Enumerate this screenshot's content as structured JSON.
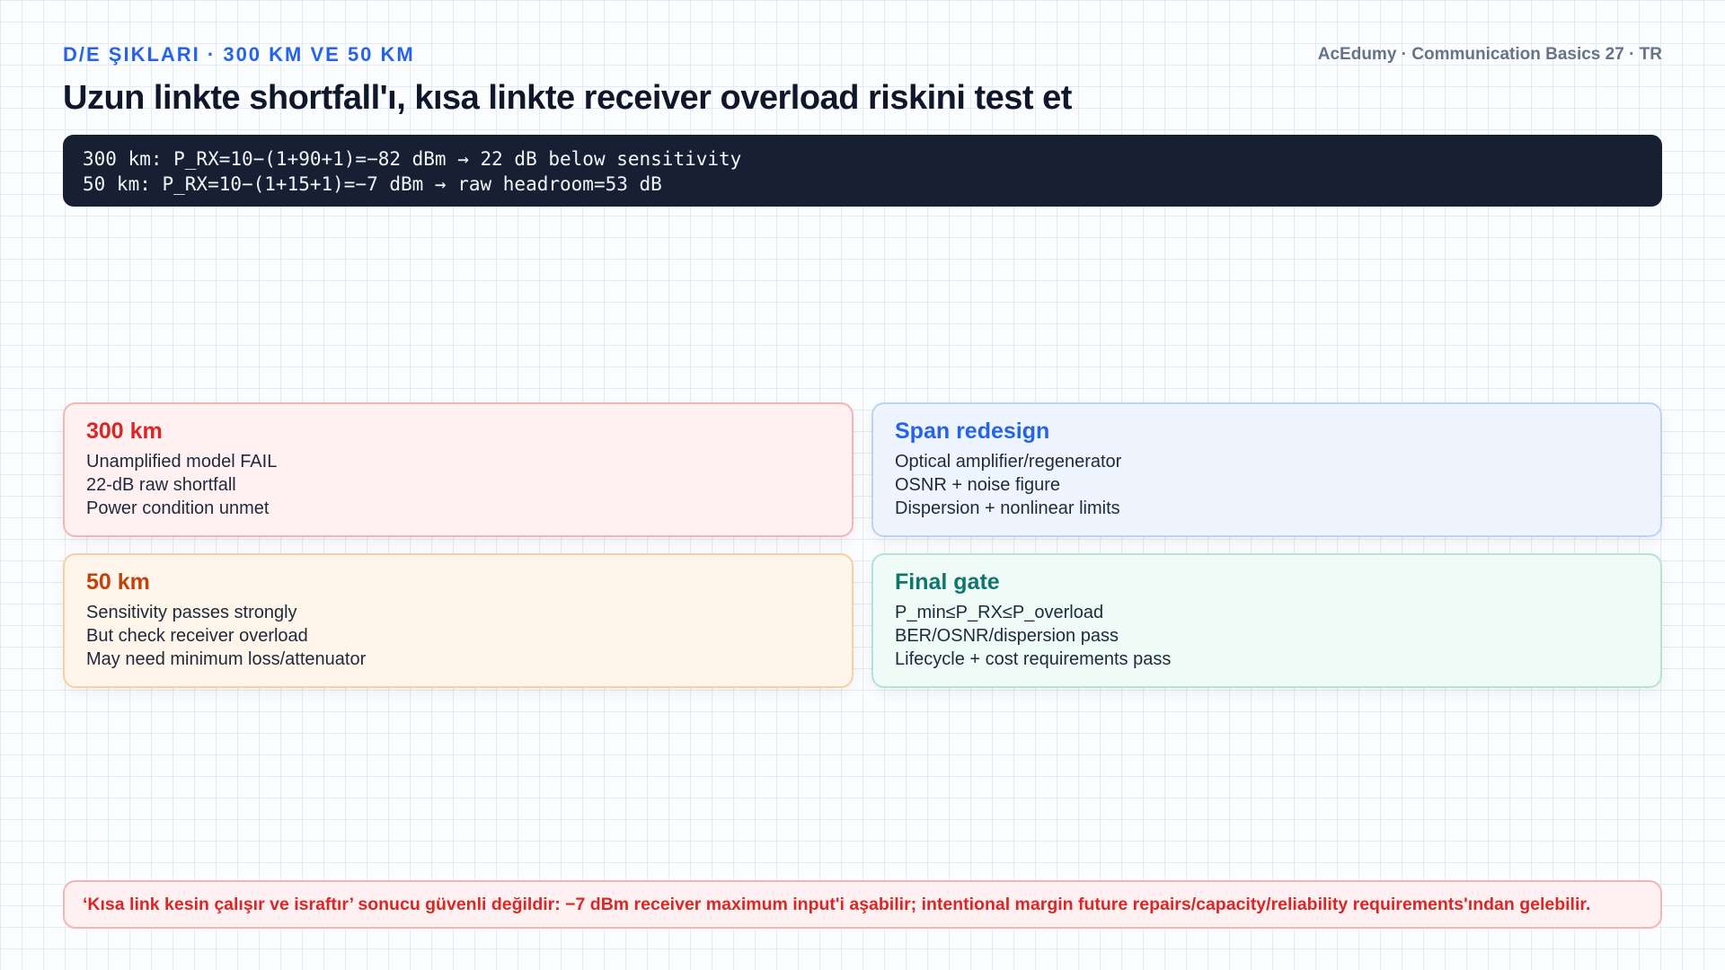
{
  "header": {
    "eyebrow": "D/E ŞIKLARI · 300 KM VE 50 KM",
    "brand": "AcEdumy · Communication Basics 27 · TR",
    "title": "Uzun linkte shortfall'ı, kısa linkte receiver overload riskini test et"
  },
  "formula": {
    "lines": [
      "300 km: P_RX=10−(1+90+1)=−82 dBm → 22 dB below sensitivity",
      "50 km: P_RX=10−(1+15+1)=−7 dBm → raw headroom=53 dB"
    ]
  },
  "cards": [
    {
      "title": "300 km",
      "lines": [
        "Unamplified model FAIL",
        "22-dB raw shortfall",
        "Power condition unmet"
      ]
    },
    {
      "title": "Span redesign",
      "lines": [
        "Optical amplifier/regenerator",
        "OSNR + noise figure",
        "Dispersion + nonlinear limits"
      ]
    },
    {
      "title": "50 km",
      "lines": [
        "Sensitivity passes strongly",
        "But check receiver overload",
        "May need minimum loss/attenuator"
      ]
    },
    {
      "title": "Final gate",
      "lines": [
        "P_min≤P_RX≤P_overload",
        "BER/OSNR/dispersion pass",
        "Lifecycle + cost requirements pass"
      ]
    }
  ],
  "footer": {
    "note": "‘Kısa link kesin çalışır ve israftır’ sonucu güvenli değildir: −7 dBm receiver maximum input'i aşabilir; intentional margin future repairs/capacity/reliability requirements'ından gelebilir."
  },
  "colors": {
    "accent_blue": "#2563eb",
    "danger_red": "#dc2626",
    "warning_orange": "#c2410c",
    "success_teal": "#0f766e",
    "code_background": "#172033"
  }
}
